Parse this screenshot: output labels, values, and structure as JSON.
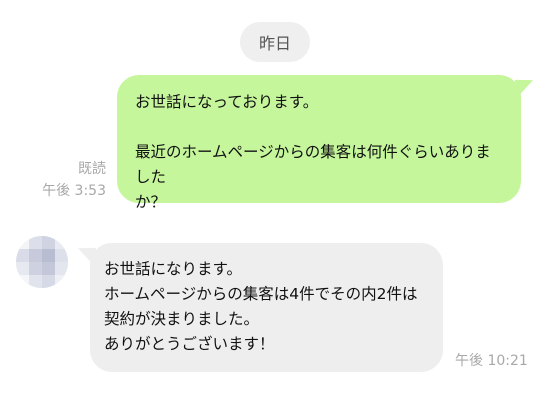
{
  "date_separator": "昨日",
  "outgoing": {
    "text": "お世話になっております。\n\n最近のホームページからの集客は何件ぐらいありました\nか？",
    "read_label": "既読",
    "time": "午後 3:53",
    "color": "#c5f69c"
  },
  "incoming": {
    "text": "お世話になります。\nホームページからの集客は4件でその内2件は\n契約が決まりました。\nありがとうございます！",
    "time": "午後 10:21",
    "color": "#eeeeee"
  }
}
